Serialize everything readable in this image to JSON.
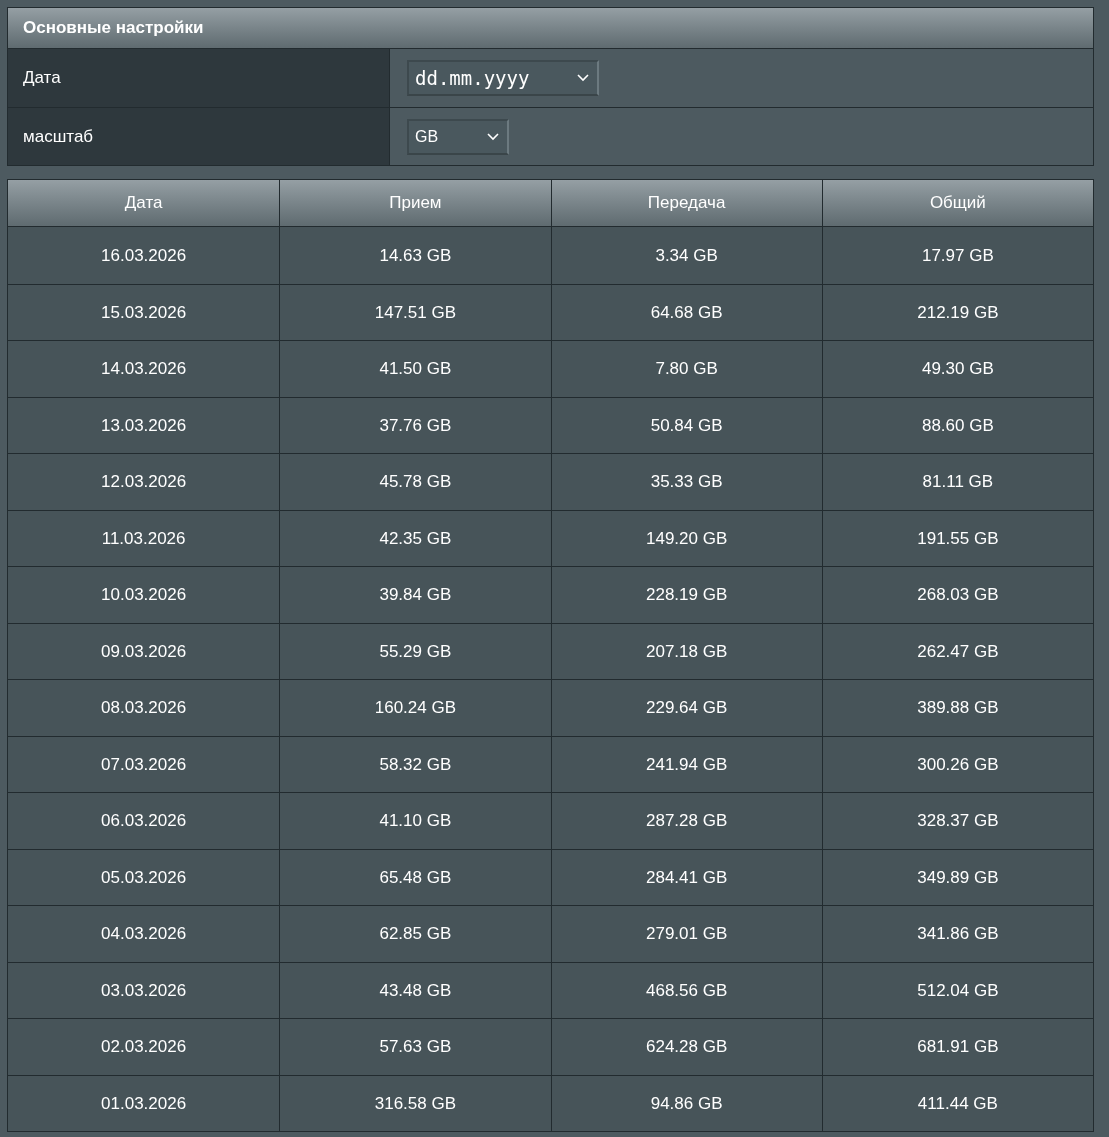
{
  "settings": {
    "title": "Основные настройки",
    "fields": [
      {
        "label": "Дата",
        "value": "dd.mm.yyyy",
        "kind": "date"
      },
      {
        "label": "масштаб",
        "value": "GB",
        "kind": "select"
      }
    ]
  },
  "table": {
    "columns": [
      "Дата",
      "Прием",
      "Передача",
      "Общий"
    ],
    "rows": [
      [
        "16.03.2026",
        "14.63 GB",
        "3.34 GB",
        "17.97 GB"
      ],
      [
        "15.03.2026",
        "147.51 GB",
        "64.68 GB",
        "212.19 GB"
      ],
      [
        "14.03.2026",
        "41.50 GB",
        "7.80 GB",
        "49.30 GB"
      ],
      [
        "13.03.2026",
        "37.76 GB",
        "50.84 GB",
        "88.60 GB"
      ],
      [
        "12.03.2026",
        "45.78 GB",
        "35.33 GB",
        "81.11 GB"
      ],
      [
        "11.03.2026",
        "42.35 GB",
        "149.20 GB",
        "191.55 GB"
      ],
      [
        "10.03.2026",
        "39.84 GB",
        "228.19 GB",
        "268.03 GB"
      ],
      [
        "09.03.2026",
        "55.29 GB",
        "207.18 GB",
        "262.47 GB"
      ],
      [
        "08.03.2026",
        "160.24 GB",
        "229.64 GB",
        "389.88 GB"
      ],
      [
        "07.03.2026",
        "58.32 GB",
        "241.94 GB",
        "300.26 GB"
      ],
      [
        "06.03.2026",
        "41.10 GB",
        "287.28 GB",
        "328.37 GB"
      ],
      [
        "05.03.2026",
        "65.48 GB",
        "284.41 GB",
        "349.89 GB"
      ],
      [
        "04.03.2026",
        "62.85 GB",
        "279.01 GB",
        "341.86 GB"
      ],
      [
        "03.03.2026",
        "43.48 GB",
        "468.56 GB",
        "512.04 GB"
      ],
      [
        "02.03.2026",
        "57.63 GB",
        "624.28 GB",
        "681.91 GB"
      ],
      [
        "01.03.2026",
        "316.58 GB",
        "94.86 GB",
        "411.44 GB"
      ]
    ]
  }
}
